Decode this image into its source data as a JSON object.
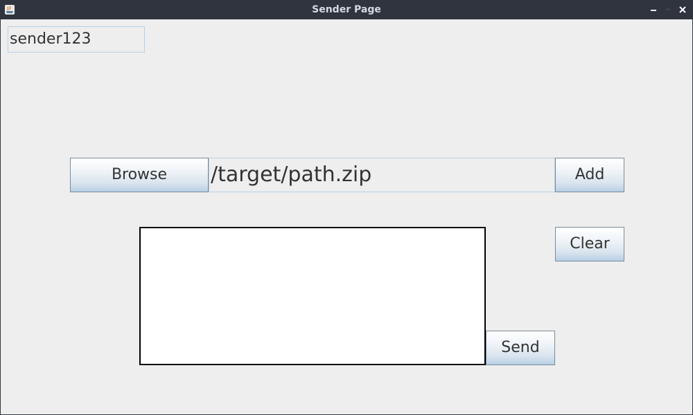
{
  "window": {
    "title": "Sender Page",
    "app_icon": "java-icon",
    "controls": {
      "minimize_icon": "minimize-icon",
      "maximize_icon": "maximize-icon",
      "close_icon": "close-icon"
    }
  },
  "sender": {
    "username_value": "sender123"
  },
  "file_picker": {
    "browse_label": "Browse",
    "path_value": "/target/path.zip",
    "add_label": "Add"
  },
  "file_list": {
    "items": []
  },
  "actions": {
    "clear_label": "Clear",
    "send_label": "Send"
  },
  "colors": {
    "titlebar": "#2f343f",
    "title_text": "#d3dae3",
    "background": "#eeeeee",
    "button_border": "#7a8a99",
    "field_border": "#b8cfe5"
  }
}
